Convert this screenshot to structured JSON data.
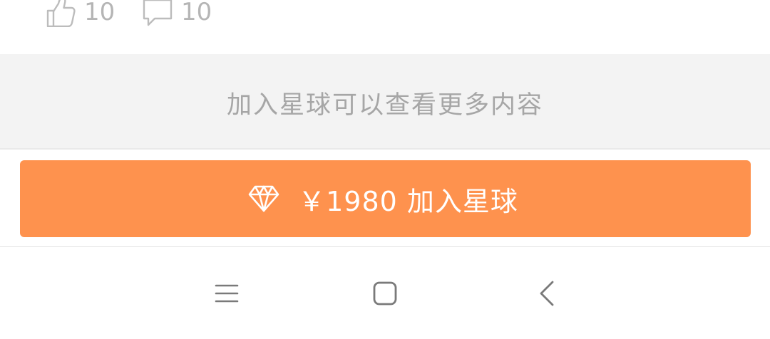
{
  "actions": {
    "like_count": "10",
    "comment_count": "10"
  },
  "hint": {
    "text": "加入星球可以查看更多内容"
  },
  "join": {
    "label": "￥1980 加入星球",
    "icon": "diamond-icon"
  },
  "navbar": {
    "menu_icon": "menu-icon",
    "home_icon": "home-icon",
    "back_icon": "back-icon"
  },
  "colors": {
    "accent": "#fe924e",
    "muted_text": "#a6a6a6",
    "band_bg": "#f3f3f3",
    "nav_icon": "#7a7a7a"
  }
}
